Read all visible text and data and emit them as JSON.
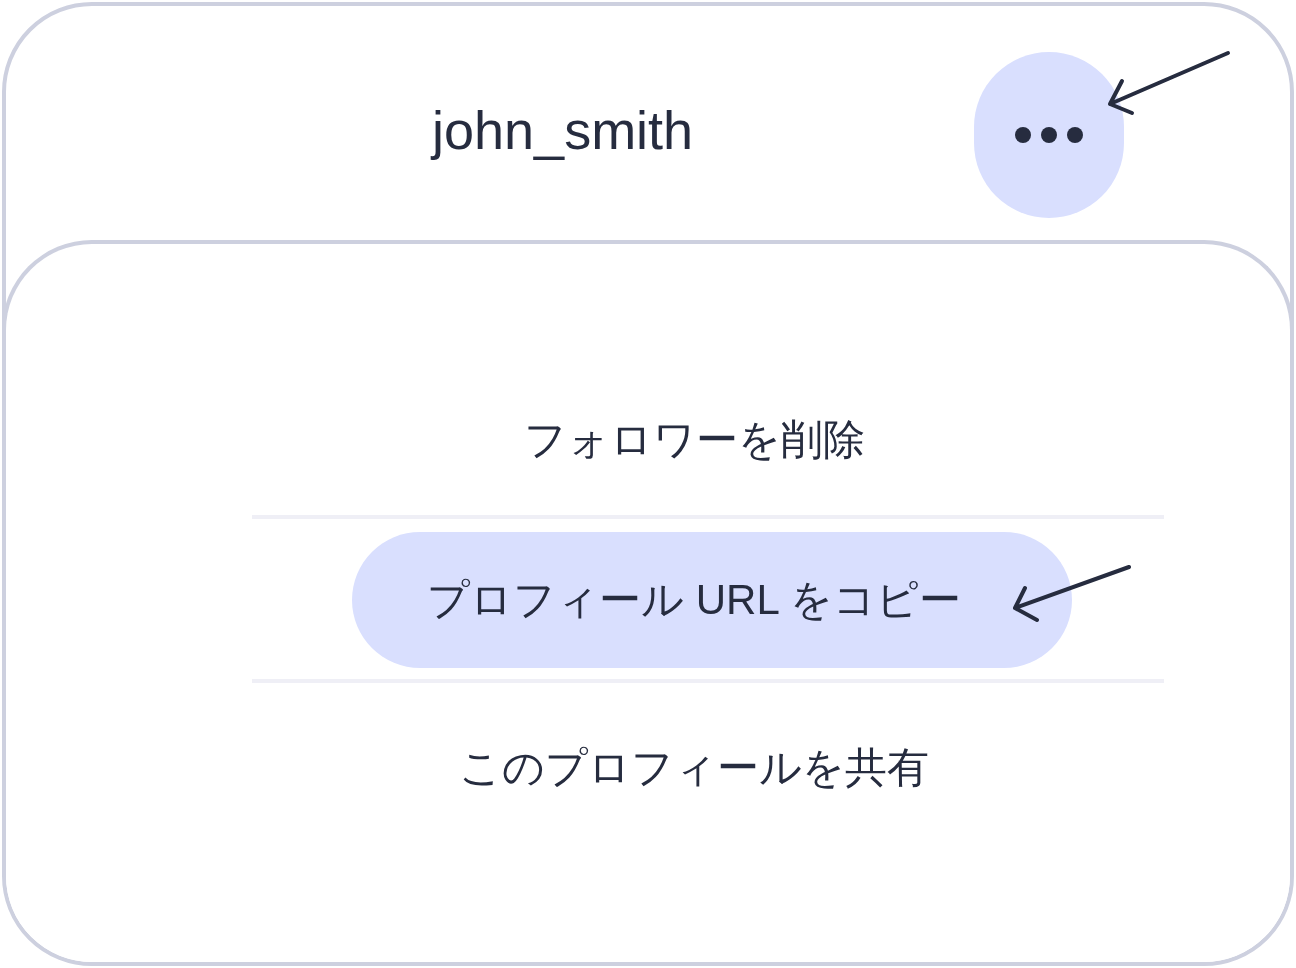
{
  "header": {
    "title": "john_smith",
    "more_button": {
      "pointer_arrow": true
    }
  },
  "menu": {
    "items": [
      {
        "label": "フォロワーを削除",
        "selected": false,
        "pointer_arrow": false
      },
      {
        "label": "プロフィール URL をコピー",
        "selected": true,
        "pointer_arrow": true
      },
      {
        "label": "このプロフィールを共有",
        "selected": false,
        "pointer_arrow": false
      }
    ]
  }
}
